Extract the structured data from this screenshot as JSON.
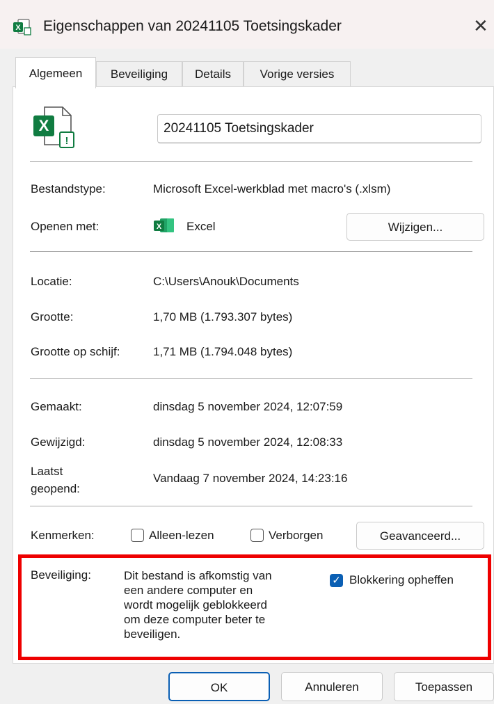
{
  "window": {
    "title": "Eigenschappen van 20241105 Toetsingskader",
    "close_glyph": "✕",
    "icon": "excel-file-icon"
  },
  "tabs": [
    {
      "label": "Algemeen",
      "active": true
    },
    {
      "label": "Beveiliging",
      "active": false
    },
    {
      "label": "Details",
      "active": false
    },
    {
      "label": "Vorige versies",
      "active": false
    }
  ],
  "general": {
    "file_icon": "excel-macro-file-icon",
    "file_name": "20241105 Toetsingskader",
    "rows": {
      "type_label": "Bestandstype:",
      "type_value": "Microsoft Excel-werkblad met macro's (.xlsm)",
      "open_label": "Openen met:",
      "open_app": "Excel",
      "change_button": "Wijzigen...",
      "location_label": "Locatie:",
      "location_value": "C:\\Users\\Anouk\\Documents",
      "size_label": "Grootte:",
      "size_value": "1,70 MB (1.793.307 bytes)",
      "disk_label": "Grootte op schijf:",
      "disk_value": "1,71 MB (1.794.048 bytes)",
      "created_label": "Gemaakt:",
      "created_value": "dinsdag 5 november 2024, 12:07:59",
      "modified_label": "Gewijzigd:",
      "modified_value": "dinsdag 5 november 2024, 12:08:33",
      "opened_label_1": "Laatst",
      "opened_label_2": "geopend:",
      "opened_value": "Vandaag 7 november 2024, 14:23:16"
    },
    "attributes": {
      "label": "Kenmerken:",
      "readonly_label": "Alleen-lezen",
      "readonly_checked": false,
      "hidden_label": "Verborgen",
      "hidden_checked": false,
      "advanced_button": "Geavanceerd..."
    },
    "security": {
      "label": "Beveiliging:",
      "text_lines": [
        "Dit bestand is afkomstig van",
        "een andere computer en",
        "wordt mogelijk geblokkeerd",
        "om deze computer beter te",
        "beveiligen."
      ],
      "unblock_label": "Blokkering opheffen",
      "unblock_checked": true,
      "highlight_color": "#ee0000"
    }
  },
  "footer": {
    "ok": "OK",
    "cancel": "Annuleren",
    "apply": "Toepassen"
  },
  "colors": {
    "excel_green": "#107c41",
    "accent_blue": "#0a5fb4"
  }
}
